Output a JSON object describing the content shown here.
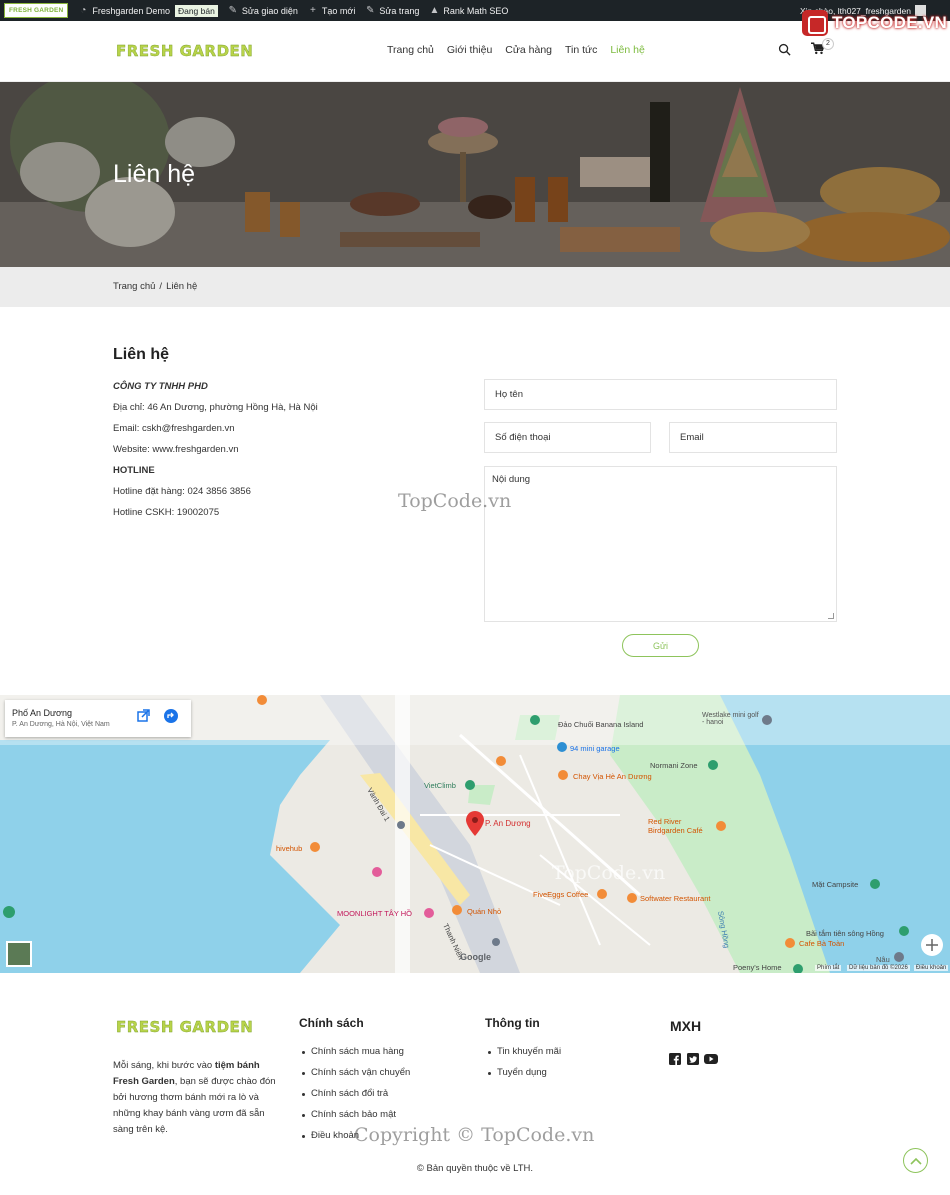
{
  "adminbar": {
    "logo_text": "FRESH GARDEN",
    "site_name": "Freshgarden Demo",
    "sale_badge": "Đang bán",
    "edit_theme": "Sửa giao diện",
    "new": "Tạo mới",
    "edit_page": "Sửa trang",
    "seo": "Rank Math SEO",
    "greeting": "Xin chào, lth027_freshgarden"
  },
  "brand_overlay": "TOPCODE.VN",
  "header": {
    "logo": "FRESH GARDEN",
    "nav": [
      "Trang chủ",
      "Giới thiệu",
      "Cửa hàng",
      "Tin tức",
      "Liên hệ"
    ],
    "active_nav": "Liên hệ",
    "cart_count": "2"
  },
  "hero": {
    "title": "Liên hệ"
  },
  "breadcrumb": {
    "home": "Trang chủ",
    "separator": "/",
    "current": "Liên hệ"
  },
  "contact": {
    "title": "Liên hệ",
    "company": "CÔNG TY TNHH PHD",
    "address": "Địa chỉ: 46 An Dương, phường Hồng Hà, Hà Nội",
    "email": "Email: cskh@freshgarden.vn",
    "website": "Website: www.freshgarden.vn",
    "hotline_heading": "HOTLINE",
    "hotline_order": "Hotline đặt hàng: 024 3856 3856",
    "hotline_care": "Hotline CSKH: 19002075"
  },
  "form": {
    "name_placeholder": "Họ tên",
    "phone_placeholder": "Số điện thoại",
    "email_placeholder": "Email",
    "message_placeholder": "Nội dung",
    "submit_label": "Gửi"
  },
  "map": {
    "place_title": "Phố An Dương",
    "place_address": "P. An Dương, Hà Nội, Việt Nam",
    "labels": {
      "banana": "Đảo Chuối Banana Island",
      "westlake": "Westlake mini golf - hanoi",
      "garage": "94 mini garage",
      "chay": "Chay Vịa Hè An Dương",
      "normani": "Normani Zone",
      "redriver": "Red River Birdgarden Café",
      "viet": "VietClimb",
      "pin": "P. An Dương",
      "hivehub": "hivehub",
      "fiveeggs": "FiveEggs Coffee",
      "softwater": "Softwater Restaurant",
      "moonlight": "MOONLIGHT TÂY HỒ",
      "quannho": "Quán Nhỏ",
      "matcampsite": "Mặt Campsite",
      "batam": "Bãi tắm tiên sông Hồng",
      "cafebatoan": "Cafe Bà Toàn",
      "poeny": "Poeny's Home",
      "nau": "Nâu",
      "vanhdai": "Vành Đai 1",
      "songhong": "Sông Hồng",
      "thanhnien": "Thanh Niên",
      "google": "Google"
    },
    "attribution": {
      "shortcuts": "Phím tắt",
      "data": "Dữ liệu bản đồ ©2026",
      "terms": "Điều khoản"
    }
  },
  "footer": {
    "logo": "FRESH GARDEN",
    "about_pre": "Mỗi sáng, khi bước vào ",
    "about_strong": "tiệm bánh Fresh Garden",
    "about_post": ", bạn sẽ được chào đón bởi hương thơm bánh mới ra lò và những khay bánh vàng ươm đã sẵn sàng trên kệ.",
    "policy_heading": "Chính sách",
    "policy_items": [
      "Chính sách mua hàng",
      "Chính sách vận chuyển",
      "Chính sách đổi trả",
      "Chính sách bảo mật",
      "Điều khoản"
    ],
    "info_heading": "Thông tin",
    "info_items": [
      "Tin khuyến mãi",
      "Tuyển dụng"
    ],
    "social_heading": "MXH",
    "copyright": "© Bản quyền thuộc về LTH."
  },
  "watermarks": {
    "w1": "TopCode.vn",
    "w2": "TopCode.vn",
    "w3": "TopCode.vn",
    "w4": "Copyright © TopCode.vn"
  },
  "colors": {
    "accent": "#7dbb3f",
    "adminbar": "#1d2327",
    "breadcrumb_bg": "#ececec",
    "water": "#8fd1ea",
    "park": "#c9ecc8"
  }
}
